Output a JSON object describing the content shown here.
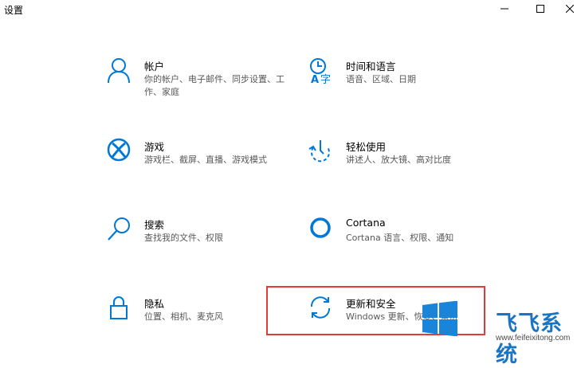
{
  "window": {
    "title": "设置"
  },
  "tiles": [
    {
      "name": "帐户",
      "desc": "你的帐户、电子邮件、同步设置、工作、家庭",
      "icon": "person-icon"
    },
    {
      "name": "时间和语言",
      "desc": "语音、区域、日期",
      "icon": "time-language-icon"
    },
    {
      "name": "游戏",
      "desc": "游戏栏、截屏、直播、游戏模式",
      "icon": "xbox-icon"
    },
    {
      "name": "轻松使用",
      "desc": "讲述人、放大镜、高对比度",
      "icon": "ease-of-access-icon"
    },
    {
      "name": "搜索",
      "desc": "查找我的文件、权限",
      "icon": "search-icon"
    },
    {
      "name": "Cortana",
      "desc": "Cortana 语言、权限、通知",
      "icon": "cortana-icon"
    },
    {
      "name": "隐私",
      "desc": "位置、相机、麦克风",
      "icon": "lock-icon"
    },
    {
      "name": "更新和安全",
      "desc": "Windows 更新、恢复、备份",
      "icon": "sync-icon"
    }
  ],
  "watermark": {
    "brand": "飞飞系统",
    "url": "www.feifeixitong.com"
  },
  "colors": {
    "accent": "#0078d7",
    "highlight_border": "#e03c3c",
    "brand_blue": "#1a74c4"
  }
}
